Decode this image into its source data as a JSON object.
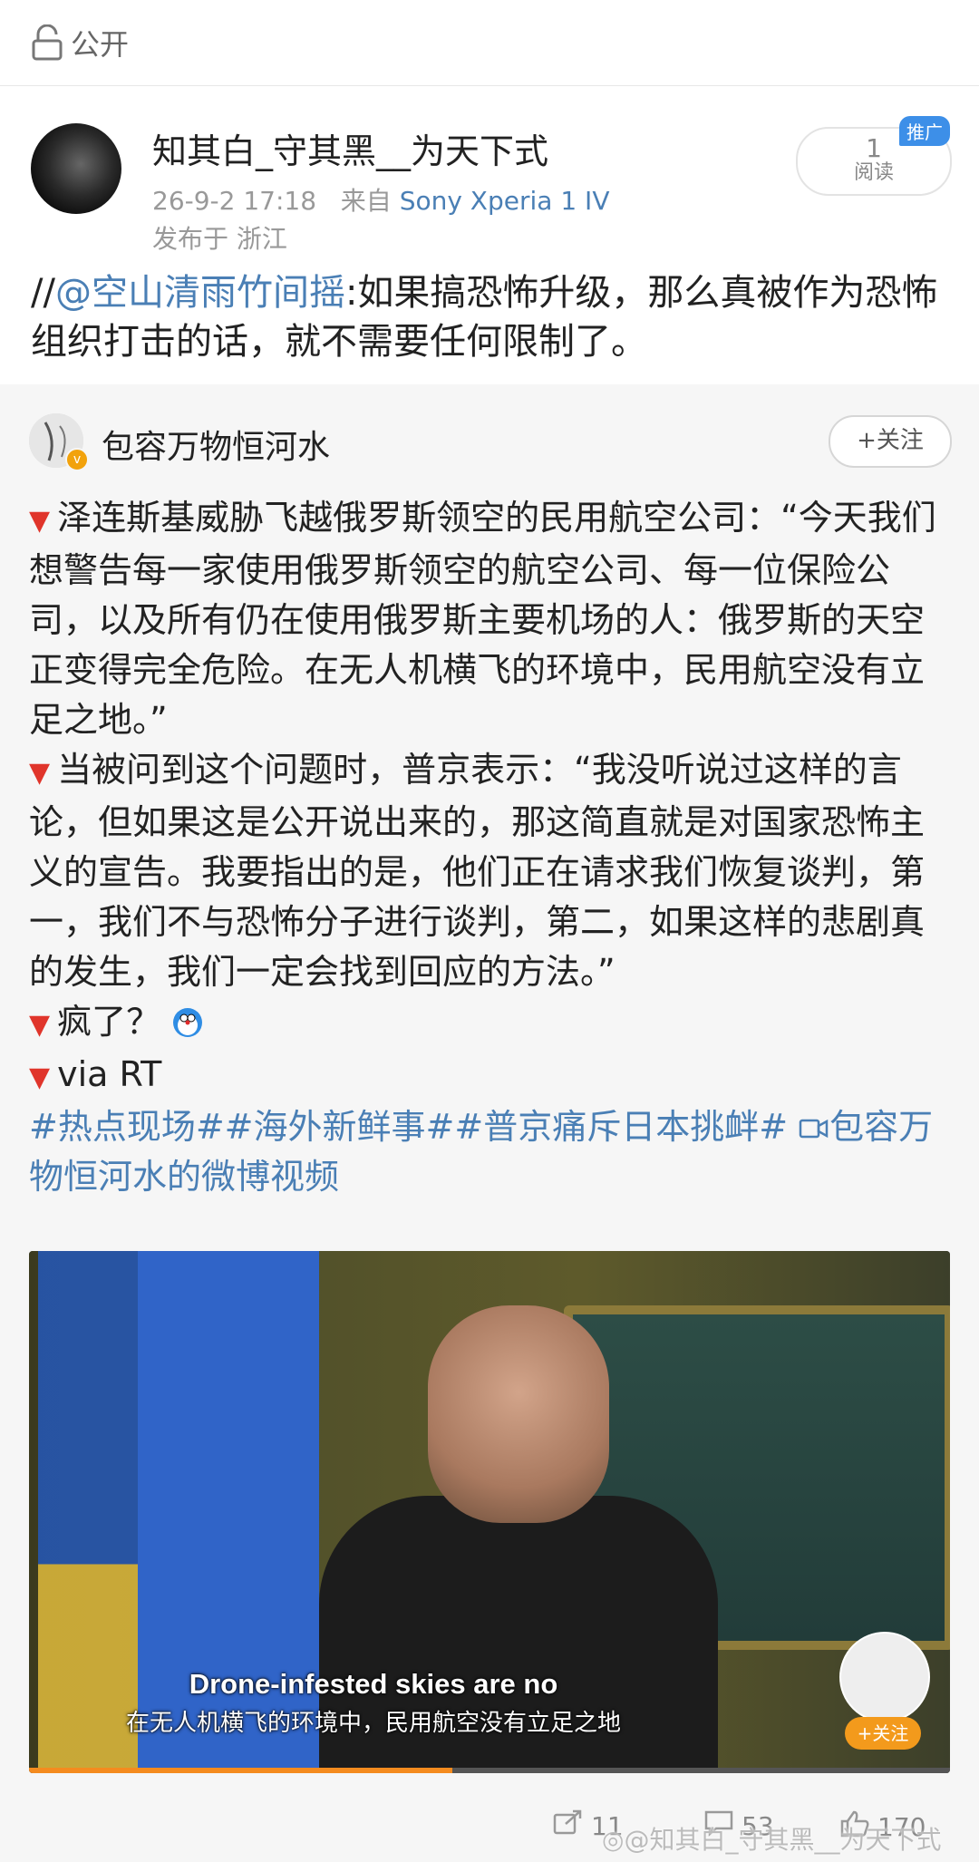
{
  "topbar": {
    "visibility_label": "公开",
    "icon": "lock-icon"
  },
  "post": {
    "author": "知其白_守其黑__为天下式",
    "timestamp": "26-9-2 17:18",
    "source_prefix": "来自",
    "device": "Sony Xperia 1 IV",
    "location": "发布于 浙江",
    "read_count": "1",
    "read_label": "阅读",
    "promo_badge": "推广",
    "repost_prefix": "//",
    "repost_mention": "@空山清雨竹间摇",
    "repost_text": ":如果搞恐怖升级，那么真被作为恐怖组织打击的话，就不需要任何限制了。"
  },
  "quoted": {
    "author": "包容万物恒河水",
    "follow_label": "+关注",
    "paragraphs": [
      "泽连斯基威胁飞越俄罗斯领空的民用航空公司：“今天我们想警告每一家使用俄罗斯领空的航空公司、每一位保险公司，以及所有仍在使用俄罗斯主要机场的人：俄罗斯的天空正变得完全危险。在无人机横飞的环境中，民用航空没有立足之地。”",
      "当被问到这个问题时，普京表示：“我没听说过这样的言论，但如果这是公开说出来的，那这简直就是对国家恐怖主义的宣告。我要指出的是，他们正在请求我们恢复谈判，第一，我们不与恐怖分子进行谈判，第二，如果这样的悲剧真的发生，我们一定会找到回应的方法。”",
      "疯了？",
      "via RT"
    ],
    "hashtags": "#热点现场##海外新鲜事##普京痛斥日本挑衅#",
    "video_link": "包容万物恒河水的微博视频",
    "video": {
      "subtitle_en": "Drone-infested skies are no",
      "subtitle_cn": "在无人机横飞的环境中，民用航空没有立足之地",
      "mini_follow": "+关注",
      "progress": 0.46
    }
  },
  "actions": {
    "reposts": "11",
    "comments": "53",
    "likes": "170"
  },
  "watermark": "@知其白_守其黑__为天下式",
  "colors": {
    "link": "#4a7fb5",
    "accent_orange": "#f48b1f",
    "promo_blue": "#3d8fe8"
  }
}
